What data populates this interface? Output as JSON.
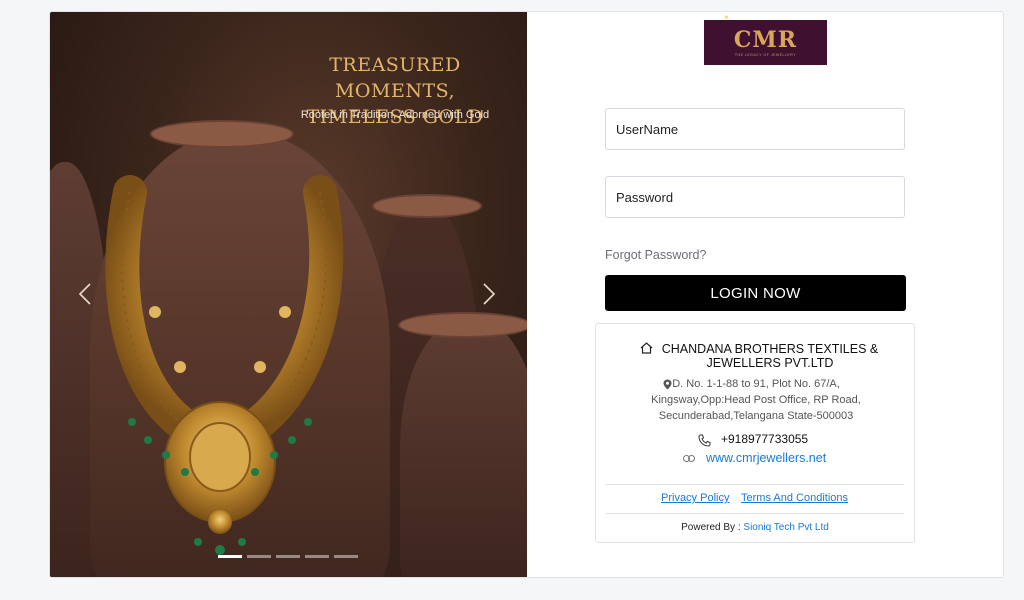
{
  "hero": {
    "title_line1": "TREASURED MOMENTS,",
    "title_line2": "TIMELESS GOLD",
    "subtitle": "Rooted in Tradition, Adorned with Gold",
    "prev_icon": "chevron-left-icon",
    "next_icon": "chevron-right-icon",
    "slide_count": 5,
    "active_slide": 1
  },
  "logo": {
    "text": "CMR",
    "tagline": "THE LEGACY OF JEWELLERY"
  },
  "form": {
    "username_placeholder": "UserName",
    "password_placeholder": "Password",
    "forgot_label": "Forgot Password?",
    "login_label": "LOGIN NOW"
  },
  "info": {
    "company_name": "CHANDANA BROTHERS TEXTILES & JEWELLERS PVT.LTD",
    "address": "D. No. 1-1-88 to 91, Plot No. 67/A, Kingsway,Opp:Head Post Office, RP Road, Secunderabad,Telangana State-500003",
    "phone": "+918977733055",
    "website": "www.cmrjewellers.net",
    "privacy_label": "Privacy Policy",
    "terms_label": "Terms And Conditions",
    "powered_prefix": "Powered By :",
    "powered_brand": "Sioniq Tech Pvt Ltd"
  },
  "colors": {
    "button_bg": "#000000",
    "link": "#1a7ad6",
    "logo_bg": "#3f1030",
    "gold": "#e3b46b"
  }
}
